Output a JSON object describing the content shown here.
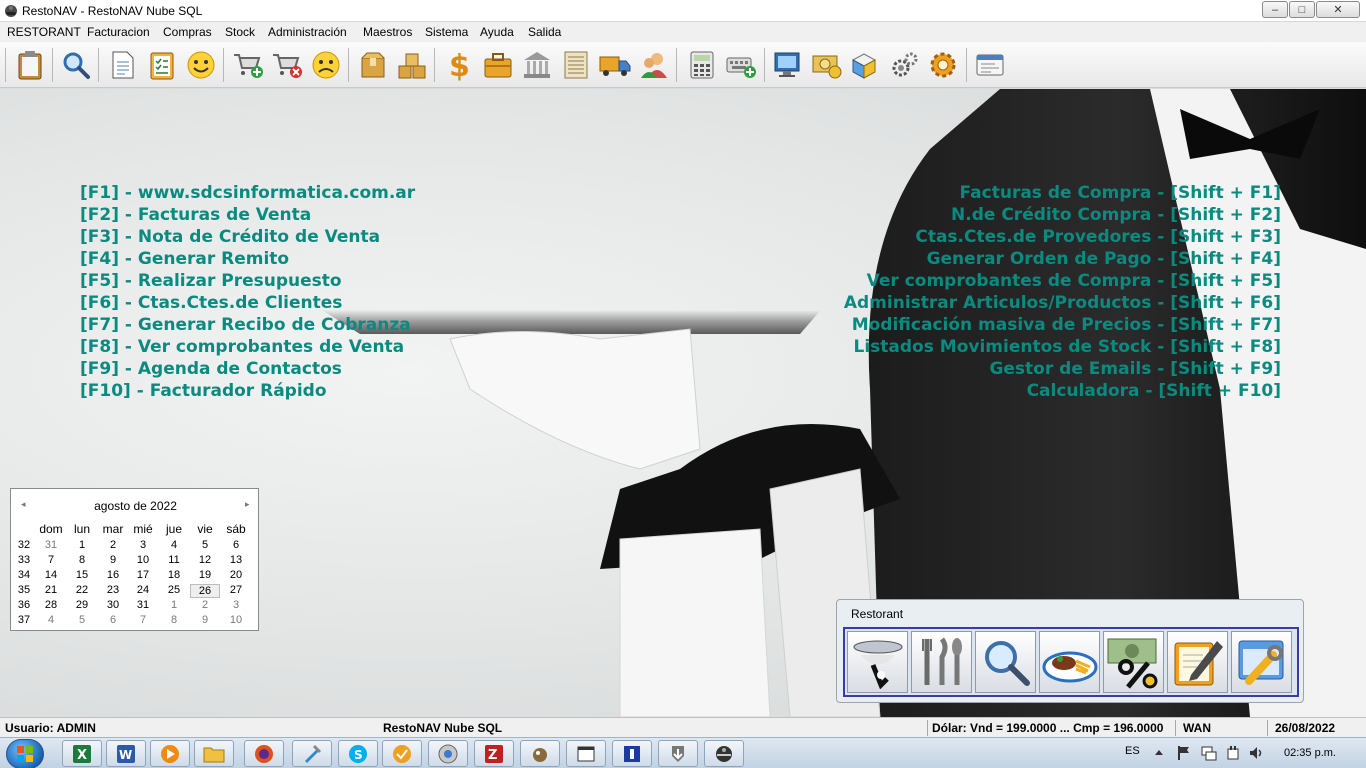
{
  "window": {
    "title": "RestoNAV - RestoNAV Nube SQL",
    "controls": {
      "minimize": "–",
      "maximize": "□",
      "close": "✕"
    }
  },
  "menu": [
    "RESTORANT",
    "Facturacion",
    "Compras",
    "Stock",
    "Administración",
    "Maestros",
    "Sistema",
    "Ayuda",
    "Salida"
  ],
  "toolbar": {
    "icons": [
      "clipboard-icon",
      "magnifier-icon",
      "document-icon",
      "checklist-icon",
      "smiley-happy-icon",
      "cart-add-icon",
      "cart-remove-icon",
      "smiley-sad-icon",
      "box-icon",
      "boxes-icon",
      "dollar-icon",
      "briefcase-icon",
      "bank-icon",
      "ledger-icon",
      "truck-icon",
      "users-icon",
      "calculator-icon",
      "keyboard-add-icon",
      "monitor-icon",
      "cash-icon",
      "packages-icon",
      "gears-icon",
      "settings-gear-icon",
      "id-card-icon"
    ]
  },
  "shortcuts_left": [
    "[F1] - www.sdcsinformatica.com.ar",
    "[F2] - Facturas de Venta",
    "[F3] - Nota de Crédito de Venta",
    "[F4] - Generar Remito",
    "[F5] - Realizar Presupuesto",
    "[F6] - Ctas.Ctes.de Clientes",
    "[F7] - Generar Recibo de Cobranza",
    "[F8] - Ver comprobantes de Venta",
    "[F9] - Agenda de Contactos",
    "[F10] - Facturador Rápido"
  ],
  "shortcuts_right": [
    "Facturas de Compra - [Shift + F1]",
    "N.de Crédito Compra - [Shift + F2]",
    "Ctas.Ctes.de Provedores - [Shift + F3]",
    "Generar Orden de Pago - [Shift + F4]",
    "Ver comprobantes de Compra - [Shift + F5]",
    "Administrar Articulos/Productos - [Shift + F6]",
    "Modificación masiva de Precios - [Shift + F7]",
    "Listados Movimientos de Stock - [Shift + F8]",
    "Gestor de Emails - [Shift + F9]",
    "Calculadora - [Shift + F10]"
  ],
  "calendar": {
    "month_label": "agosto de 2022",
    "prev": "◂",
    "next": "▸",
    "weekdays": [
      "dom",
      "lun",
      "mar",
      "mié",
      "jue",
      "vie",
      "sáb"
    ],
    "weeks": [
      {
        "num": "32",
        "days": [
          {
            "d": "31",
            "m": true
          },
          {
            "d": "1"
          },
          {
            "d": "2"
          },
          {
            "d": "3"
          },
          {
            "d": "4"
          },
          {
            "d": "5"
          },
          {
            "d": "6"
          }
        ]
      },
      {
        "num": "33",
        "days": [
          {
            "d": "7"
          },
          {
            "d": "8"
          },
          {
            "d": "9"
          },
          {
            "d": "10"
          },
          {
            "d": "11"
          },
          {
            "d": "12"
          },
          {
            "d": "13"
          }
        ]
      },
      {
        "num": "34",
        "days": [
          {
            "d": "14"
          },
          {
            "d": "15"
          },
          {
            "d": "16"
          },
          {
            "d": "17"
          },
          {
            "d": "18"
          },
          {
            "d": "19"
          },
          {
            "d": "20"
          }
        ]
      },
      {
        "num": "35",
        "days": [
          {
            "d": "21"
          },
          {
            "d": "22"
          },
          {
            "d": "23"
          },
          {
            "d": "24"
          },
          {
            "d": "25"
          },
          {
            "d": "26",
            "today": true
          },
          {
            "d": "27"
          }
        ]
      },
      {
        "num": "36",
        "days": [
          {
            "d": "28"
          },
          {
            "d": "29"
          },
          {
            "d": "30"
          },
          {
            "d": "31"
          },
          {
            "d": "1",
            "m": true
          },
          {
            "d": "2",
            "m": true
          },
          {
            "d": "3",
            "m": true
          }
        ]
      },
      {
        "num": "37",
        "days": [
          {
            "d": "4",
            "m": true
          },
          {
            "d": "5",
            "m": true
          },
          {
            "d": "6",
            "m": true
          },
          {
            "d": "7",
            "m": true
          },
          {
            "d": "8",
            "m": true
          },
          {
            "d": "9",
            "m": true
          },
          {
            "d": "10",
            "m": true
          }
        ]
      }
    ]
  },
  "restorant_panel": {
    "title": "Restorant",
    "buttons": [
      "tray-icon",
      "cutlery-icon",
      "search-glass-icon",
      "plate-food-icon",
      "discount-percent-icon",
      "edit-note-icon",
      "tools-window-icon"
    ]
  },
  "statusbar": {
    "user": "Usuario: ADMIN",
    "app": "RestoNAV Nube SQL",
    "dollar": "Dólar: Vnd = 199.0000 ... Cmp = 196.0000",
    "network": "WAN",
    "date": "26/08/2022"
  },
  "taskbar": {
    "items": [
      "excel-icon",
      "word-icon",
      "media-player-icon",
      "folder-icon",
      "firefox-icon",
      "tool-icon",
      "skype-icon",
      "outlook-icon",
      "browser-icon",
      "filezilla-icon",
      "gimp-icon",
      "window-icon",
      "app-blue-icon",
      "installer-icon",
      "restonav-icon"
    ],
    "lang": "ES",
    "time": "02:35 p.m."
  },
  "colors": {
    "shortcut": "#0b8a80",
    "panel_border": "#3a3aa8"
  }
}
